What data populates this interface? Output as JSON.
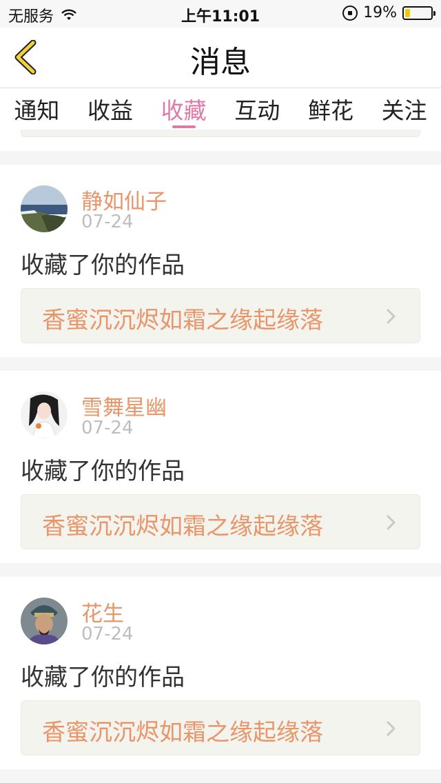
{
  "status_bar": {
    "carrier": "无服务",
    "time": "上午11:01",
    "battery": "19%",
    "battery_level": 0.19
  },
  "nav": {
    "title": "消息"
  },
  "tabs": [
    {
      "label": "通知"
    },
    {
      "label": "收益"
    },
    {
      "label": "收藏",
      "active": true
    },
    {
      "label": "互动"
    },
    {
      "label": "鲜花"
    },
    {
      "label": "关注"
    }
  ],
  "messages": [
    {
      "username": "静如仙子",
      "date": "07-24",
      "action": "收藏了你的作品",
      "work_title": "香蜜沉沉烬如霜之缘起缘落"
    },
    {
      "username": "雪舞星幽",
      "date": "07-24",
      "action": "收藏了你的作品",
      "work_title": "香蜜沉沉烬如霜之缘起缘落"
    },
    {
      "username": "花生",
      "date": "07-24",
      "action": "收藏了你的作品",
      "work_title": "香蜜沉沉烬如霜之缘起缘落"
    }
  ],
  "colors": {
    "accent_pink": "#e079a8",
    "username_orange": "#e8956a",
    "back_icon_yellow": "#f2d23a"
  }
}
